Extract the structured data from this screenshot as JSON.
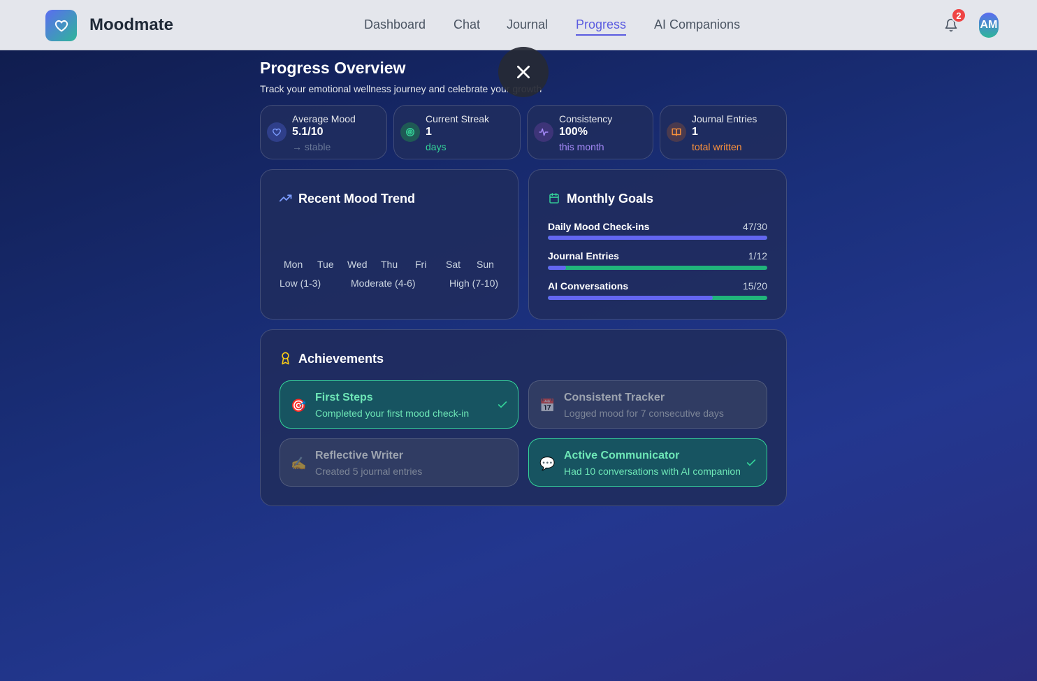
{
  "app": {
    "name": "Moodmate"
  },
  "nav": {
    "items": [
      {
        "label": "Dashboard",
        "active": false
      },
      {
        "label": "Chat",
        "active": false
      },
      {
        "label": "Journal",
        "active": false
      },
      {
        "label": "Progress",
        "active": true
      },
      {
        "label": "AI Companions",
        "active": false
      }
    ],
    "notification_count": "2",
    "avatar_initials": "AM"
  },
  "header": {
    "title": "Progress Overview",
    "subtitle": "Track your emotional wellness journey and celebrate your growth"
  },
  "stats": [
    {
      "label": "Average Mood",
      "value": "5.1/10",
      "sub": "→ stable",
      "icon": "heart-icon",
      "color": "#93a3b8"
    },
    {
      "label": "Current Streak",
      "value": "1",
      "sub": "days",
      "icon": "target-icon",
      "color": "#34d399"
    },
    {
      "label": "Consistency",
      "value": "100%",
      "sub": "this month",
      "icon": "activity-icon",
      "color": "#a78bfa"
    },
    {
      "label": "Journal Entries",
      "value": "1",
      "sub": "total written",
      "icon": "book-icon",
      "color": "#fb923c"
    }
  ],
  "mood_trend": {
    "title": "Recent Mood Trend",
    "days": [
      "Mon",
      "Tue",
      "Wed",
      "Thu",
      "Fri",
      "Sat",
      "Sun"
    ],
    "legend": [
      "Low (1-3)",
      "Moderate (4-6)",
      "High (7-10)"
    ]
  },
  "goals": {
    "title": "Monthly Goals",
    "items": [
      {
        "name": "Daily Mood Check-ins",
        "value": "47/30",
        "progress": 1.0
      },
      {
        "name": "Journal Entries",
        "value": "1/12",
        "progress": 0.083
      },
      {
        "name": "AI Conversations",
        "value": "15/20",
        "progress": 0.75
      }
    ]
  },
  "achievements": {
    "title": "Achievements",
    "items": [
      {
        "name": "First Steps",
        "desc": "Completed your first mood check-in",
        "unlocked": true,
        "emoji": "🎯"
      },
      {
        "name": "Consistent Tracker",
        "desc": "Logged mood for 7 consecutive days",
        "unlocked": false,
        "emoji": "📅"
      },
      {
        "name": "Reflective Writer",
        "desc": "Created 5 journal entries",
        "unlocked": false,
        "emoji": "✍️"
      },
      {
        "name": "Active Communicator",
        "desc": "Had 10 conversations with AI companion",
        "unlocked": true,
        "emoji": "💬"
      }
    ]
  },
  "colors": {
    "accent": "#5b5ce0",
    "success": "#34d399",
    "goal_fill": "#6366f1",
    "goal_track": "#20b47b"
  }
}
